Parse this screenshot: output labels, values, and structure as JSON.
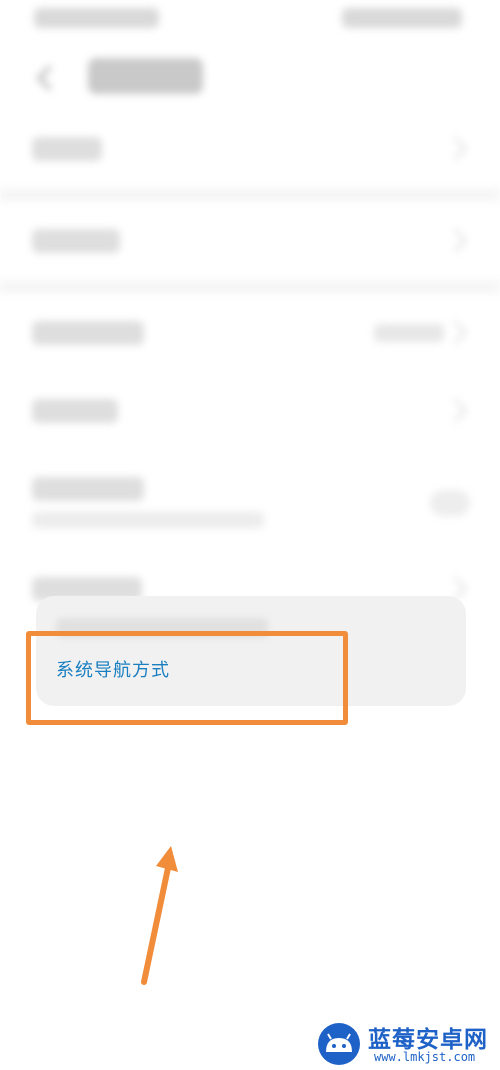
{
  "card": {
    "link_label": "系统导航方式"
  },
  "watermark": {
    "title": "蓝莓安卓网",
    "url": "www.lmkjst.com"
  },
  "colors": {
    "link": "#1a7fc1",
    "annotation": "#f08c3a",
    "watermark": "#1e62c8"
  }
}
